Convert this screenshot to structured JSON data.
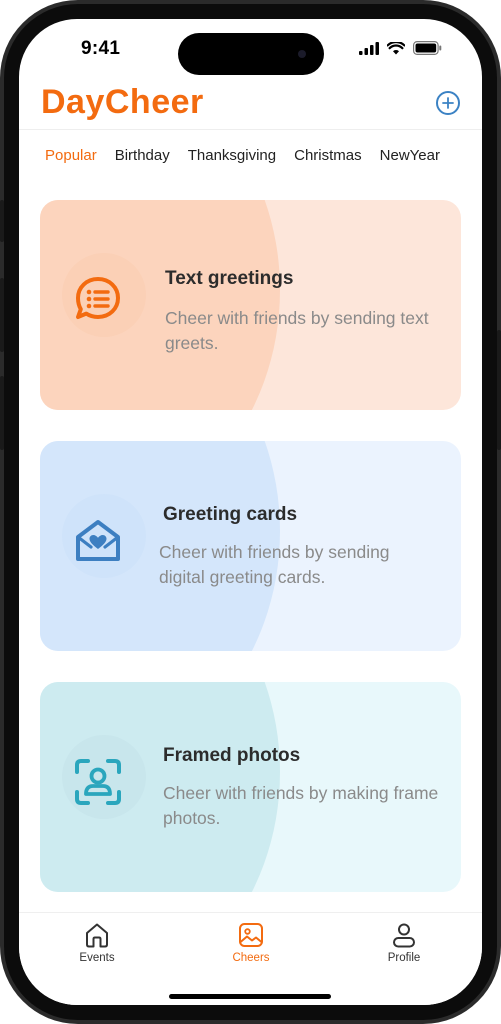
{
  "status_bar": {
    "time": "9:41"
  },
  "header": {
    "brand": "DayCheer",
    "add_icon": "plus-circle-icon"
  },
  "tabs": [
    "Popular",
    "Birthday",
    "Thanksgiving",
    "Christmas",
    "NewYear"
  ],
  "active_tab": "Popular",
  "cards": [
    {
      "title": "Text greetings",
      "description": "Cheer with friends by sending text greets.",
      "icon": "chat-bubble-icon",
      "bg_color": "#fde6da",
      "swoosh_color": "#fcd4bd",
      "icon_circle_color": "#fbd0b6",
      "icon_color": "#f36b10"
    },
    {
      "title": "Greeting cards",
      "description": "Cheer with friends by sending digital greeting cards.",
      "icon": "envelope-heart-icon",
      "bg_color": "#ebf3fe",
      "swoosh_color": "#d4e6fb",
      "icon_circle_color": "#cfe3fa",
      "icon_color": "#3d7fc1"
    },
    {
      "title": "Framed photos",
      "description": "Cheer with friends by making frame photos.",
      "icon": "portrait-frame-icon",
      "bg_color": "#e8f8fb",
      "swoosh_color": "#cdebf0",
      "icon_circle_color": "#c8e6ec",
      "icon_color": "#2aa6bd"
    }
  ],
  "nav": [
    {
      "label": "Events",
      "icon": "home-icon"
    },
    {
      "label": "Cheers",
      "icon": "image-icon"
    },
    {
      "label": "Profile",
      "icon": "person-icon"
    }
  ],
  "active_nav": "Cheers",
  "colors": {
    "accent": "#f36b10",
    "link_blue": "#3b82c4"
  }
}
